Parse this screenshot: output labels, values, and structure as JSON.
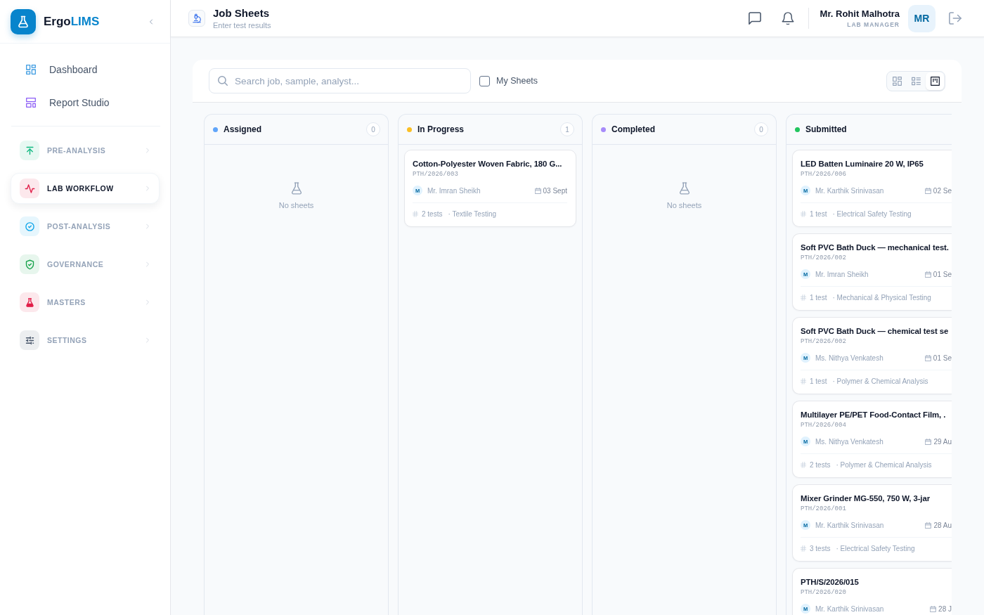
{
  "sidebar": {
    "brand": {
      "prefix": "Ergo",
      "suffix": "LIMS"
    },
    "links": [
      {
        "label": "Dashboard",
        "color": "#3b9ae1"
      },
      {
        "label": "Report Studio",
        "color": "#8b5cf6"
      }
    ],
    "sections": [
      {
        "label": "PRE-ANALYSIS",
        "color": "#10b981",
        "selected": false
      },
      {
        "label": "LAB WORKFLOW",
        "color": "#e11d48",
        "selected": true
      },
      {
        "label": "POST-ANALYSIS",
        "color": "#0ea5e9",
        "selected": false
      },
      {
        "label": "GOVERNANCE",
        "color": "#16a34a",
        "selected": false
      },
      {
        "label": "MASTERS",
        "color": "#e11d48",
        "selected": false
      },
      {
        "label": "SETTINGS",
        "color": "#475569",
        "selected": false
      }
    ]
  },
  "header": {
    "title": "Job Sheets",
    "subtitle": "Enter test results",
    "user": {
      "name": "Mr. Rohit Malhotra",
      "role": "LAB MANAGER",
      "initials": "MR"
    }
  },
  "toolbar": {
    "search": {
      "placeholder": "Search job, sample, analyst..."
    },
    "my_sheets": {
      "label": "My Sheets",
      "checked": false
    },
    "views": [
      {
        "kind": "grid",
        "selected": false
      },
      {
        "kind": "list",
        "selected": false
      },
      {
        "kind": "board",
        "selected": true
      }
    ]
  },
  "columns": [
    {
      "title": "Assigned",
      "color": "#60a5fa",
      "count": "0",
      "empty_text": "No sheets"
    },
    {
      "title": "In Progress",
      "color": "#fbbf24",
      "count": "1",
      "cards": [
        {
          "title": "Cotton-Polyester Woven Fabric, 180 G...",
          "code": "PTH/2026/003",
          "initial": "M",
          "analyst": "Mr. Imran Sheikh",
          "date": "03 Sept",
          "tests": "2 tests",
          "category": "· Textile Testing"
        }
      ]
    },
    {
      "title": "Completed",
      "color": "#a78bfa",
      "count": "0",
      "empty_text": "No sheets"
    },
    {
      "title": "Submitted",
      "color": "#22c55e",
      "cards": [
        {
          "title": "LED Batten Luminaire 20 W, IP65",
          "code": "PTH/2026/006",
          "initial": "M",
          "analyst": "Mr. Karthik Srinivasan",
          "date": "02 Se",
          "tests": "1 test",
          "category": "· Electrical Safety Testing"
        },
        {
          "title": "Soft PVC Bath Duck — mechanical test.",
          "code": "PTH/2026/002",
          "initial": "M",
          "analyst": "Mr. Imran Sheikh",
          "date": "01 Se",
          "tests": "1 test",
          "category": "· Mechanical & Physical Testing"
        },
        {
          "title": "Soft PVC Bath Duck — chemical test se",
          "code": "PTH/2026/002",
          "initial": "M",
          "analyst": "Ms. Nithya Venkatesh",
          "date": "01 Se",
          "tests": "1 test",
          "category": "· Polymer & Chemical Analysis"
        },
        {
          "title": "Multilayer PE/PET Food-Contact Film, .",
          "code": "PTH/2026/004",
          "initial": "M",
          "analyst": "Ms. Nithya Venkatesh",
          "date": "29 Au",
          "tests": "2 tests",
          "category": "· Polymer & Chemical Analysis"
        },
        {
          "title": "Mixer Grinder MG-550, 750 W, 3-jar",
          "code": "PTH/2026/001",
          "initial": "M",
          "analyst": "Mr. Karthik Srinivasan",
          "date": "28 Au",
          "tests": "3 tests",
          "category": "· Electrical Safety Testing"
        },
        {
          "title": "PTH/S/2026/015",
          "code": "PTH/2026/020",
          "initial": "M",
          "analyst": "Mr. Karthik Srinivasan",
          "date": "28 J"
        }
      ]
    }
  ]
}
